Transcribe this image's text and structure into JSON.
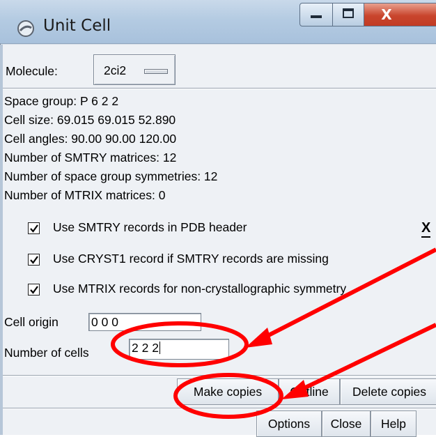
{
  "window": {
    "title": "Unit Cell",
    "close_glyph": "X"
  },
  "molecule": {
    "label": "Molecule:",
    "selected": "2ci2"
  },
  "info": {
    "space_group": "Space group: P 6 2 2",
    "cell_size": "Cell size:  69.015  69.015  52.890",
    "cell_angles": "Cell angles:  90.00  90.00 120.00",
    "smtry_count": "Number of SMTRY matrices: 12",
    "symmetry_count": "Number of space group symmetries: 12",
    "mtrix_count": "Number of MTRIX matrices: 0"
  },
  "options": {
    "use_smtry": {
      "label": "Use SMTRY records in PDB header",
      "checked": true
    },
    "use_cryst1": {
      "label": "Use CRYST1 record if SMTRY records are missing",
      "checked": true
    },
    "use_mtrix": {
      "label": "Use MTRIX records for non-crystallographic symmetry",
      "checked": true
    },
    "clear_glyph": "X"
  },
  "cell_origin": {
    "label": "Cell origin",
    "value": "0 0 0"
  },
  "num_cells": {
    "label": "Number of cells",
    "value": "2 2 2"
  },
  "actions": {
    "make_copies": "Make copies",
    "outline": "Outline",
    "delete_copies": "Delete copies"
  },
  "footer": {
    "options": "Options",
    "close": "Close",
    "help": "Help"
  },
  "colors": {
    "annotation": "#ff0000",
    "close_button": "#c9452d"
  },
  "icons": [
    "app-icon",
    "minimize-icon",
    "maximize-icon",
    "close-icon",
    "checkmark-icon",
    "clear-x-icon"
  ]
}
